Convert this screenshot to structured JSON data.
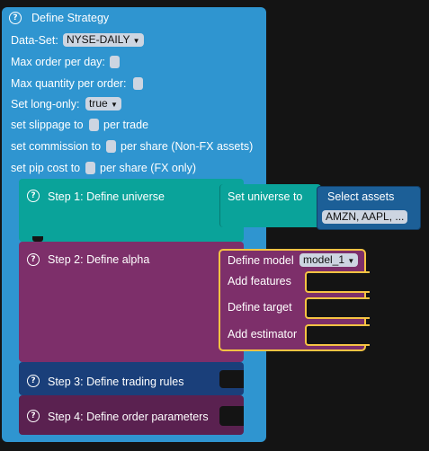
{
  "strategy": {
    "title": "Define Strategy",
    "dataset_label": "Data-Set:",
    "dataset_value": "NYSE-DAILY",
    "max_order_label": "Max order per day:",
    "max_qty_label": "Max quantity per order:",
    "long_only_label": "Set long-only:",
    "long_only_value": "true",
    "slippage_pre": "set slippage to",
    "slippage_post": "per trade",
    "commission_pre": "set commission to",
    "commission_post": "per share (Non-FX assets)",
    "pip_pre": "set pip cost to",
    "pip_post": "per share (FX only)",
    "icon": "question-icon"
  },
  "step1": {
    "label": "Step 1: Define universe",
    "set_universe": "Set universe to",
    "select_assets": "Select assets",
    "assets_value": "AMZN, AAPL, ..."
  },
  "step2": {
    "label": "Step 2: Define alpha",
    "define_model": "Define model",
    "model_value": "model_1",
    "add_features": "Add features",
    "define_target": "Define target",
    "add_estimator": "Add estimator"
  },
  "step3": {
    "label": "Step 3: Define trading rules"
  },
  "step4": {
    "label": "Step 4: Define order parameters"
  },
  "colors": {
    "strategy": "#2f95d0",
    "step1": "#0aa39a",
    "step2": "#7d2f6a",
    "step3": "#1a3f7a",
    "step4": "#5a2150",
    "assets": "#1c5f97",
    "highlight": "#f6c343"
  }
}
